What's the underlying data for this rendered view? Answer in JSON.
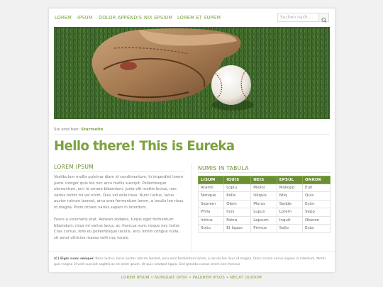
{
  "nav": {
    "items": [
      "LOREM",
      "IPSUM",
      "DOLOR APPENDIS",
      "NIX EPSIUM",
      "LOREM ET SUPEM"
    ],
    "search_placeholder": "Suchen nach ..."
  },
  "breadcrumb": {
    "prefix": "Sie sind hier:",
    "current": "Startseite"
  },
  "headline": "Hello there! This is Eureka",
  "left": {
    "title": "LOREM IPSUM",
    "paragraphs": [
      "Vestibulum mollis pulvinar diam id condimentum. In imperdiet lorem justo. Integer quis leo nec arcu mollis suscipit. Pellentesque elementum, orci id ornare bibendum, justo elit mattis lectus, non varius tortor mi vel enim. Duis vel odio risus. Nunc luctus, lacus auctor rutrum laoreet, arcu eros fermentum lorem, a iaculis leo risus id magna. Proin ornare varius sapien in interdum.",
      "Fusce a venenatis erat. Aenean sodales, turpis eget fermentum bibendum, risus mi varius lacus, ac rhoncus nunc neque nec tortor. Cras cursus, felis eu pellentesque iaculis, arcu lorem congue nulla, sit amet ultricies massa velit nec turpis."
    ]
  },
  "right": {
    "title": "NUMIS IN TABULA",
    "table": {
      "headers": [
        "LISUM",
        "IQUIS",
        "NEIS",
        "EPSUL",
        "ONKOK"
      ],
      "rows": [
        [
          "Aramli",
          "Lopiu",
          "Mioioi",
          "Mollopo",
          "Eull"
        ],
        [
          "Nonque",
          "Kolle",
          "Uliquis",
          "Niiq",
          "Quis"
        ],
        [
          "Seprem",
          "Olem",
          "Morus",
          "Sedde",
          "Exim"
        ],
        [
          "Phila",
          "Inxs",
          "Lupus",
          "Lorem",
          "Sepp"
        ],
        [
          "Inktus",
          "Fahra",
          "Lepsum",
          "Inquit",
          "Oberon"
        ],
        [
          "Sixtu",
          "Et loppo",
          "Primus",
          "Solio",
          "Exta"
        ]
      ]
    }
  },
  "footer": {
    "label": "(C) Elgin nunc semper.",
    "text": "Nunc luctus, lacus auctor rutrum laoreet, arcu eros fermentum lorem, a iaculis leo risus id magna. Proin ornare varius sapien in interdum. Morbi quis magna id velit suscipit sagittis ac sit amet ipsum. Ut quis volutpat ligula. Sed gravida cursus lorem sed rhoncus."
  },
  "bottom_links": [
    "LOREM IPSUM",
    "NUMQUAT OPSO",
    "PALUREM IPSOS",
    "NECAT QUIDOM"
  ],
  "colors": {
    "accent": "#7ca23e",
    "table_header": "#6b8f33"
  }
}
